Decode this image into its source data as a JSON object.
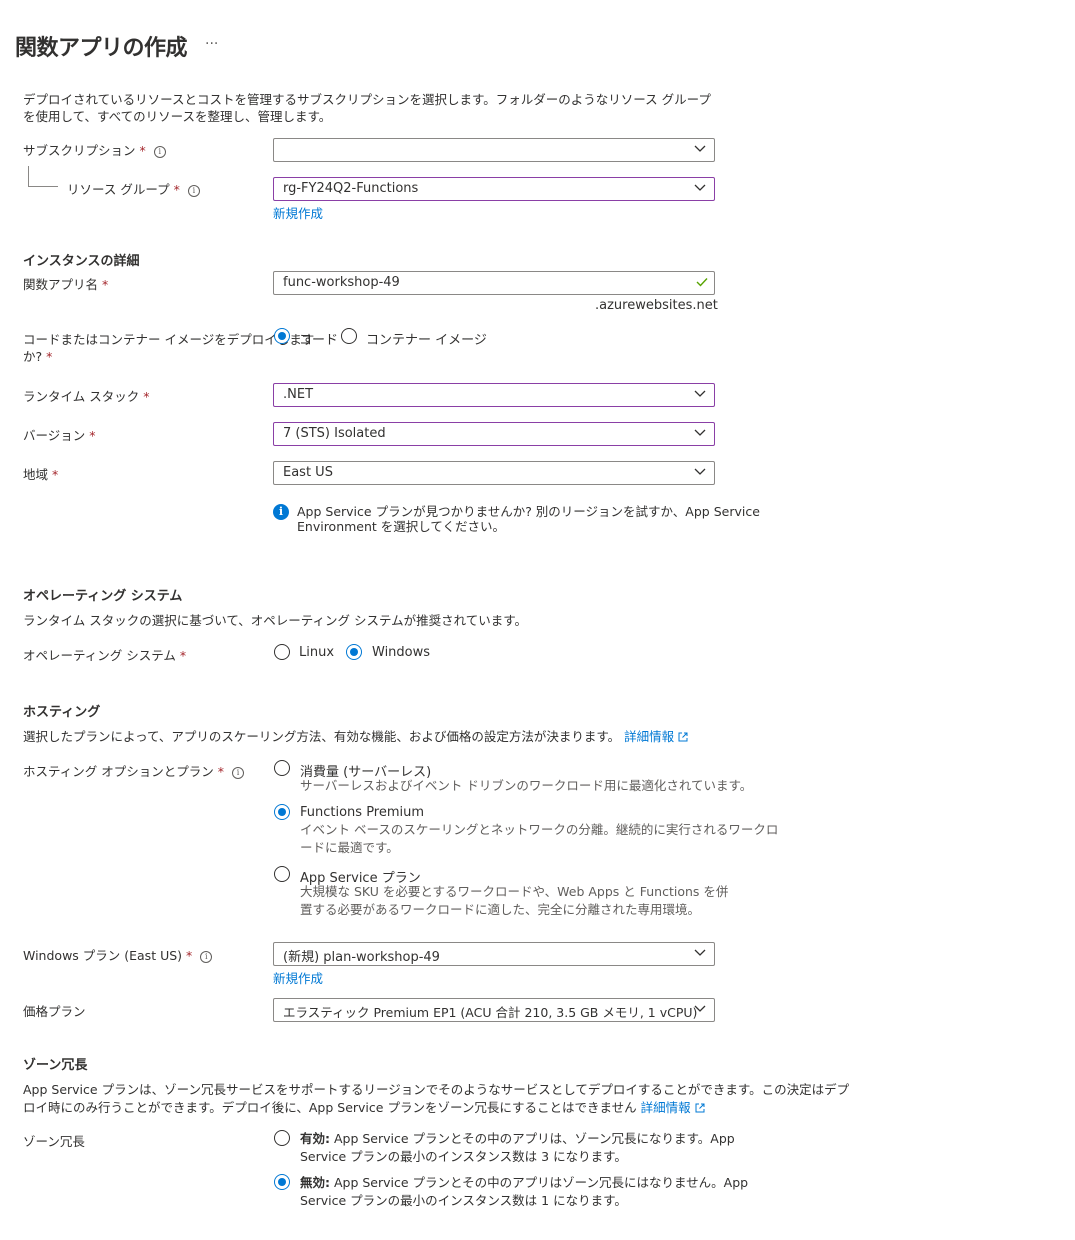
{
  "header": {
    "title": "関数アプリの作成",
    "more": "···"
  },
  "intro": "デプロイされているリソースとコストを管理するサブスクリプションを選択します。フォルダーのようなリソース グループを使用して、すべてのリソースを整理し、管理します。",
  "subscription": {
    "label": "サブスクリプション",
    "value": ""
  },
  "resource_group": {
    "label": "リソース グループ",
    "value": "rg-FY24Q2-Functions",
    "create_new": "新規作成"
  },
  "instance": {
    "heading": "インスタンスの詳細",
    "app_name_label": "関数アプリ名",
    "app_name_value": "func-workshop-49",
    "suffix": ".azurewebsites.net",
    "deploy_label_1": "コードまたはコンテナー イメージをデプロイします",
    "deploy_label_2": "か?",
    "deploy_code": "コード",
    "deploy_container": "コンテナー イメージ",
    "runtime_label": "ランタイム スタック",
    "runtime_value": ".NET",
    "version_label": "バージョン",
    "version_value": "7 (STS) Isolated",
    "region_label": "地域",
    "region_value": "East US",
    "notice_1": "App Service プランが見つかりませんか? 別のリージョンを試すか、App Service",
    "notice_2": "Environment を選択してください。"
  },
  "os": {
    "heading": "オペレーティング システム",
    "desc": "ランタイム スタックの選択に基づいて、オペレーティング システムが推奨されています。",
    "label": "オペレーティング システム",
    "linux": "Linux",
    "windows": "Windows"
  },
  "hosting": {
    "heading": "ホスティング",
    "desc": "選択したプランによって、アプリのスケーリング方法、有効な機能、および価格の設定方法が決まります。",
    "learn_more": "詳細情報",
    "label": "ホスティング オプションとプラン",
    "options": [
      {
        "title": "消費量 (サーバーレス)",
        "desc_1": "サーバーレスおよびイベント ドリブンのワークロード用に最適化されています。",
        "desc_2": ""
      },
      {
        "title": "Functions Premium",
        "desc_1": "イベント ベースのスケーリングとネットワークの分離。継続的に実行されるワークロ",
        "desc_2": "ードに最適です。"
      },
      {
        "title": "App Service プラン",
        "desc_1": "大規模な SKU を必要とするワークロードや、Web Apps と Functions を併",
        "desc_2": "置する必要があるワークロードに適した、完全に分離された専用環境。"
      }
    ],
    "plan_label": "Windows プラン (East US)",
    "plan_value": "(新規) plan-workshop-49",
    "plan_create_new": "新規作成",
    "pricing_label": "価格プラン",
    "pricing_value": "エラスティック Premium EP1 (ACU 合計 210, 3.5 GB メモリ, 1 vCPU)"
  },
  "zone": {
    "heading": "ゾーン冗長",
    "desc_1": "App Service プランは、ゾーン冗長サービスをサポートするリージョンでそのようなサービスとしてデプロイすることができます。この決定はデプ",
    "desc_2": "ロイ時にのみ行うことができます。デプロイ後に、App Service プランをゾーン冗長にすることはできません",
    "learn_more": "詳細情報",
    "label": "ゾーン冗長",
    "enabled_bold": "有効:",
    "enabled_1": " App Service プランとその中のアプリは、ゾーン冗長になります。App",
    "enabled_2": "Service プランの最小のインスタンス数は 3 になります。",
    "disabled_bold": "無効:",
    "disabled_1": " App Service プランとその中のアプリはゾーン冗長にはなりません。App",
    "disabled_2": "Service プランの最小のインスタンス数は 1 になります。"
  },
  "required_mark": "*",
  "info_glyph": "i"
}
